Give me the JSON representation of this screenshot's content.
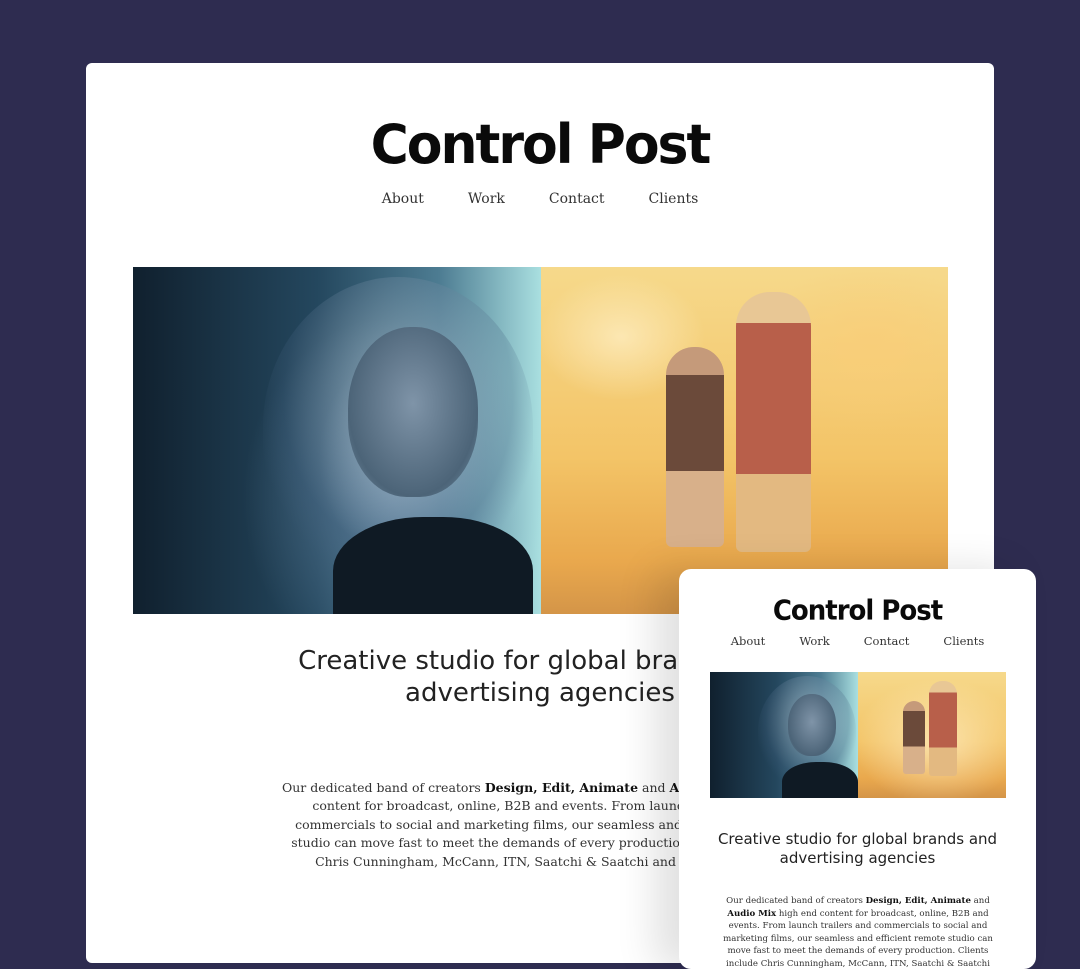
{
  "brand": {
    "name": "Control Post"
  },
  "nav": {
    "items": [
      "About",
      "Work",
      "Contact",
      "Clients"
    ]
  },
  "hero": {
    "left_image": "portrait-blue",
    "right_image": "mother-daughter-yellow"
  },
  "headline": "Creative studio for global brands and advertising agencies",
  "intro": {
    "text_1": "Our dedicated band of creators ",
    "bold_1": "Design, Edit, Animate",
    "text_2": " and ",
    "bold_2": "Audio Mix",
    "text_3": " high end content for broadcast, online, B2B and events. From launch trailers and commercials to social and marketing films, our seamless and efficient remote studio can move fast to meet the demands of every production. Clients include Chris Cunningham, McCann, ITN, Saatchi & Saatchi and Codemasters."
  },
  "colors": {
    "background": "#2e2c50",
    "card": "#ffffff",
    "text": "#222222"
  }
}
